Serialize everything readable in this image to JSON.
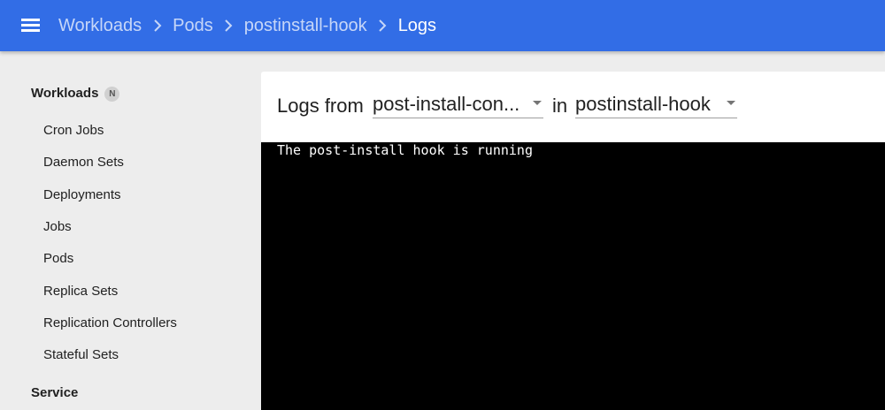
{
  "header": {
    "breadcrumbs": [
      "Workloads",
      "Pods",
      "postinstall-hook",
      "Logs"
    ]
  },
  "sidebar": {
    "workloads_title": "Workloads",
    "namespace_badge": "N",
    "items": [
      {
        "label": "Cron Jobs"
      },
      {
        "label": "Daemon Sets"
      },
      {
        "label": "Deployments"
      },
      {
        "label": "Jobs"
      },
      {
        "label": "Pods"
      },
      {
        "label": "Replica Sets"
      },
      {
        "label": "Replication Controllers"
      },
      {
        "label": "Stateful Sets"
      }
    ],
    "service_title": "Service"
  },
  "logs": {
    "from_label": "Logs from",
    "container_select": "post-install-con...",
    "in_label": "in",
    "pod_select": "postinstall-hook",
    "lines": [
      "The post-install hook is running"
    ]
  },
  "colors": {
    "topbar": "#326de6",
    "sidebar": "#ededed",
    "console": "#000000"
  }
}
